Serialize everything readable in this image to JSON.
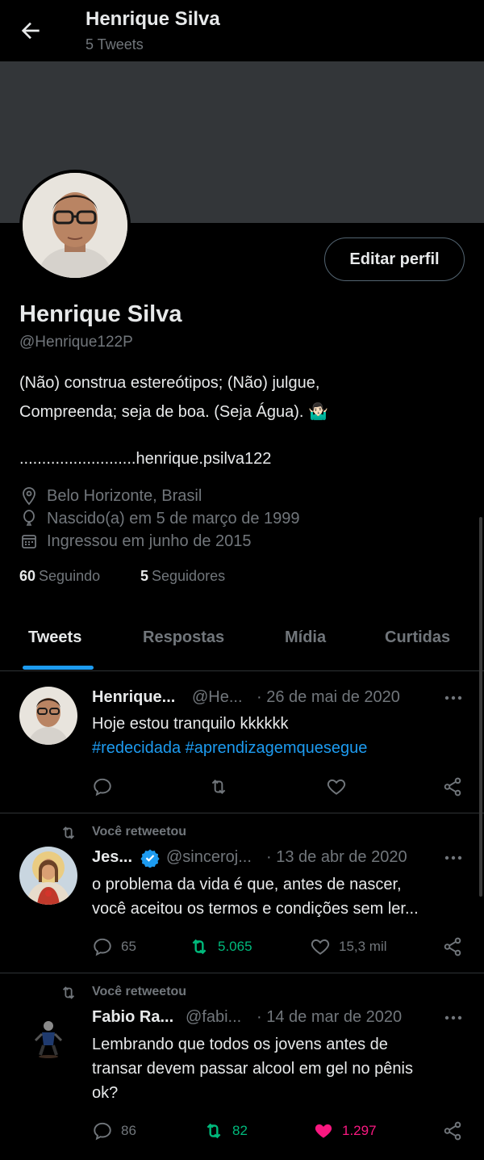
{
  "header": {
    "title": "Henrique Silva",
    "tweet_count": "5 Tweets"
  },
  "profile": {
    "name": "Henrique Silva",
    "handle": "@Henrique122P",
    "edit_button": "Editar perfil",
    "bio_line1": "(Não) construa estereótipos; (Não) julgue,",
    "bio_line2": "Compreenda; seja de boa. (Seja Água). 🤷🏻‍♂️",
    "bio_line3": "..........................henrique.psilva122",
    "location": "Belo Horizonte, Brasil",
    "birth": "Nascido(a) em 5 de março de 1999",
    "joined": "Ingressou em junho de 2015",
    "following_count": "60",
    "following_label": "Seguindo",
    "followers_count": "5",
    "followers_label": "Seguidores"
  },
  "tabs": [
    {
      "label": "Tweets"
    },
    {
      "label": "Respostas"
    },
    {
      "label": "Mídia"
    },
    {
      "label": "Curtidas"
    }
  ],
  "tweets": [
    {
      "name": "Henrique...",
      "handle": "@He...",
      "date": "· 26 de mai de 2020",
      "text_line1": "Hoje estou tranquilo kkkkkk",
      "hashtag1": "#redecidada",
      "hashtag2": "#aprendizagemquesegue"
    },
    {
      "retweet_label": "Você retweetou",
      "name": "Jes...",
      "handle": "@sinceroj...",
      "date": "· 13 de abr de 2020",
      "text_line1": "o problema da vida é que, antes de nascer,",
      "text_line2": "você aceitou os termos e condições sem ler...",
      "replies": "65",
      "retweets": "5.065",
      "likes": "15,3 mil"
    },
    {
      "retweet_label": "Você retweetou",
      "name": "Fabio Ra...",
      "handle": "@fabi...",
      "date": "· 14 de mar de 2020",
      "text_line1": "Lembrando que todos os jovens antes de",
      "text_line2": "transar devem passar alcool em gel no pênis",
      "text_line3": "ok?",
      "replies": "86",
      "retweets": "82",
      "likes": "1.297"
    }
  ],
  "colors": {
    "accent": "#1d9bf0",
    "retweet_green": "#00ba7c",
    "like_pink": "#f91880",
    "muted": "#71767b"
  }
}
